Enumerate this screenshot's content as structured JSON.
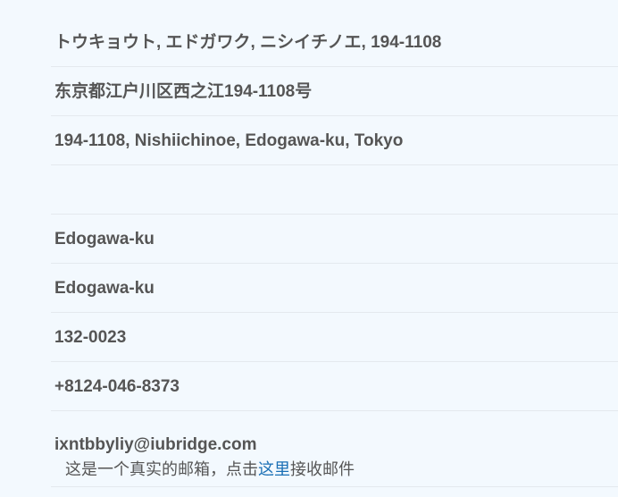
{
  "address": {
    "katakana": "トウキョウト, エドガワク, ニシイチノエ, 194-1108",
    "kanji": "东京都江户川区西之江194-1108号",
    "romaji": "194-1108, Nishiichinoe, Edogawa-ku, Tokyo",
    "empty": "",
    "city": "Edogawa-ku",
    "ward": "Edogawa-ku",
    "postal_code": "132-0023",
    "phone": "+8124-046-8373",
    "email": "ixntbbyliy@iubridge.com"
  },
  "email_note": {
    "prefix": "这是一个真实的邮箱，点击",
    "link": "这里",
    "suffix": "接收邮件"
  }
}
